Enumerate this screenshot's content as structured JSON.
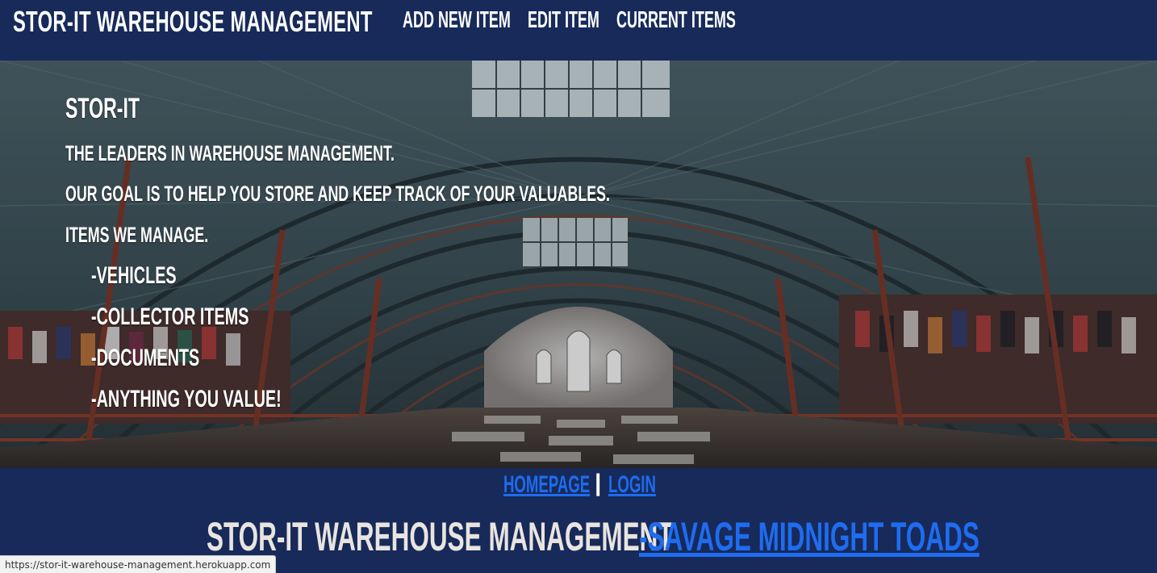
{
  "navbar": {
    "brand": "Stor-It Warehouse Management",
    "links": [
      "Add New Item",
      "Edit Item",
      "Current Items"
    ]
  },
  "hero": {
    "title": "Stor-It",
    "tagline": "The leaders in warehouse management.",
    "goal": "Our goal is to help you store and keep track of your valuables.",
    "items_heading": "Items we manage.",
    "items": [
      "-Vehicles",
      "-Collector Items",
      "-Documents",
      "-Anything you value!"
    ]
  },
  "footer": {
    "links": [
      "Homepage",
      "Login"
    ],
    "separator": "|",
    "credits_text": "Stor-It Warehouse Management",
    "credits_link": "-Savage Midnight Toads"
  },
  "status_url": "https://stor-it-warehouse-management.herokuapp.com",
  "colors": {
    "navy": "#172a5a",
    "link_blue": "#1e6cf0",
    "credits_text": "#e9e4df"
  }
}
